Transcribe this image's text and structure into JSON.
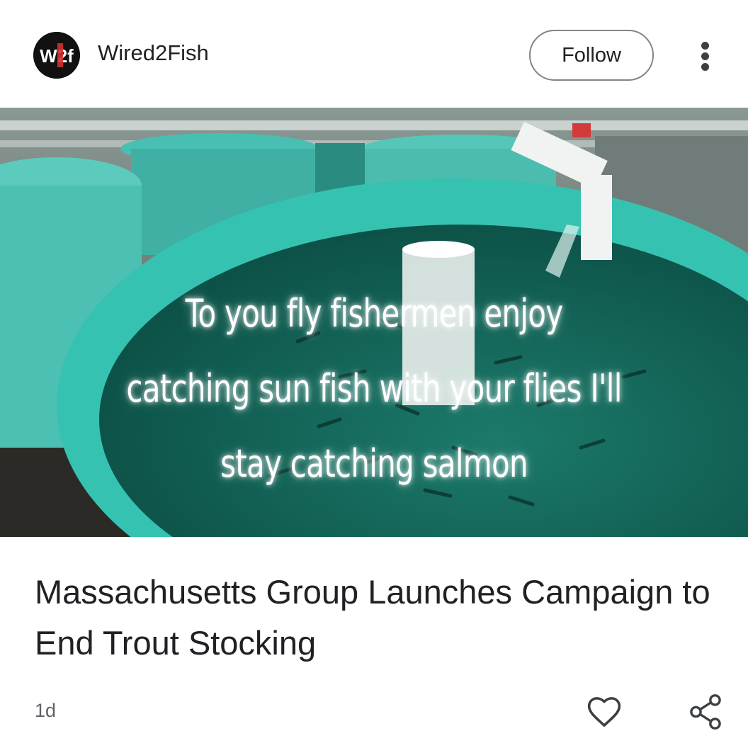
{
  "header": {
    "logo_text": "W2f",
    "publisher": "Wired2Fish",
    "follow_label": "Follow",
    "more_icon": "more-vert-icon"
  },
  "hero": {
    "caption_lines": [
      "To you fly fishermen enjoy",
      "catching sun fish with your flies I'll",
      "stay catching salmon"
    ]
  },
  "article": {
    "headline": "Massachusetts Group Launches Campaign to End Trout Stocking",
    "age": "1d"
  },
  "actions": {
    "like_icon": "heart-outline-icon",
    "share_icon": "share-icon"
  },
  "colors": {
    "tank_teal": "#2fb8aa",
    "water": "#0f5e52",
    "text": "#202124",
    "muted": "#5f6368"
  }
}
